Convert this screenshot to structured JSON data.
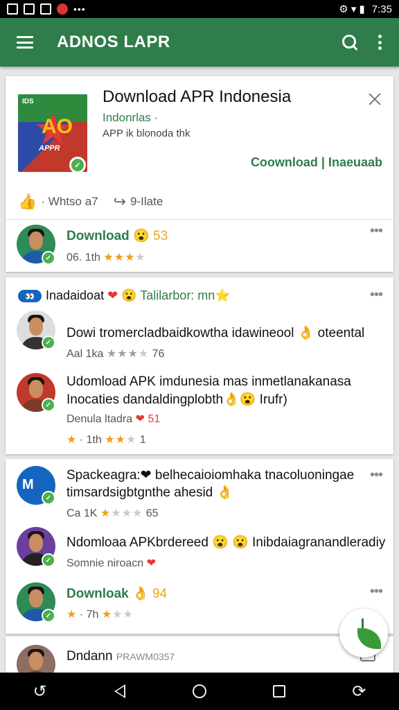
{
  "status_bar": {
    "time": "7:35",
    "right_glyphs": "⚙ ▾ ▮"
  },
  "app_bar": {
    "title": "ADNOS LAPR"
  },
  "feature": {
    "logo_top": "IDS",
    "logo_bottom": "APPR",
    "title": "Download APR Indonesia",
    "sub1": "Indonrlas ·",
    "sub2": "APP ik blonoda thk",
    "button": "Coownload | Inaeuaab",
    "action_like": "· Whtso a7",
    "action_share": "9-Ilate"
  },
  "rows": [
    {
      "title": "Download",
      "emoji": "😮 53",
      "meta": "06. 1th",
      "stars_on": 3,
      "stars_total": 4,
      "extra": ""
    },
    {
      "section_label": "Inadaidoat",
      "section_emoji": "❤ 😮",
      "section_tail": "Talilarbor: mn⭐"
    },
    {
      "title": "Dowi tromercladbaidkowtha idawineool 👌 oteental",
      "meta": "Aal 1ka",
      "stars_on": 0,
      "stars_total": 4,
      "extra": "76"
    },
    {
      "title": "Udomload APK imdunesia mas inmetlanakanasa",
      "title2": "Inocaties dandaldingplobth👌😮 Irufr)",
      "meta": "Denula ltadra",
      "meta_emoji": "❤ 51",
      "meta2_a": "· 1th",
      "stars_on": 2,
      "stars_total": 4,
      "extra": "1"
    },
    {
      "title": "Spackeagra:❤ belhecaioiomhaka tnacoluoningae",
      "title2": "timsardsigbtgnthe ahesid 👌",
      "meta": "Ca 1K",
      "stars_on": 1,
      "stars_total": 4,
      "extra": "65"
    },
    {
      "title": "Ndomloaa APKbrdereed 😮 😮 Inibdaiagranandleradiy",
      "meta": "Somnie niroacn",
      "meta_emoji": "❤"
    },
    {
      "title": "Downloak",
      "emoji": "👌 94",
      "meta": "· 7h",
      "stars_on": 1,
      "stars_total": 4
    },
    {
      "title": "Dndann",
      "tail": "PRAWM0357"
    }
  ],
  "colors": {
    "accent": "#2e7d4a",
    "star": "#f39c12",
    "fab_leaf": "#3a9a3a"
  },
  "icons": [
    "menu-icon",
    "search-icon",
    "more-vert-icon",
    "close-icon",
    "thumb-up-icon",
    "share-icon",
    "check-icon",
    "overflow-icon",
    "leaf-icon",
    "back-icon",
    "home-icon",
    "recents-icon"
  ]
}
